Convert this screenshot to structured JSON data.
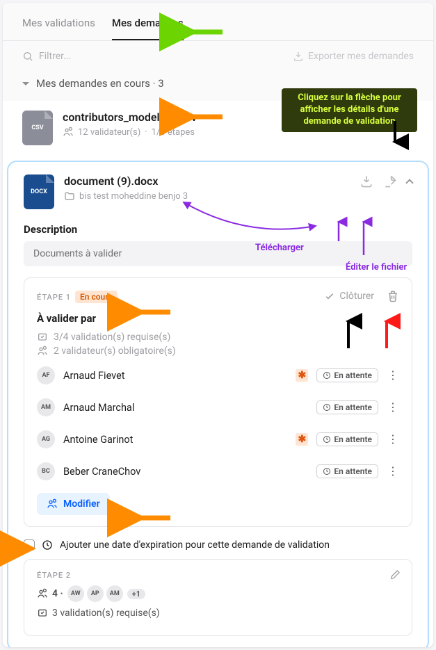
{
  "tabs": {
    "validations": "Mes validations",
    "demandes": "Mes demandes"
  },
  "toolbar": {
    "filter_placeholder": "Filtrer...",
    "export_label": "Exporter mes demandes"
  },
  "section": {
    "title": "Mes demandes en cours · 3"
  },
  "file1": {
    "ext": "CSV",
    "name": "contributors_model (1).csv",
    "validators": "12 validateur(s)",
    "steps": "1/3 étapes",
    "count": "12"
  },
  "file2": {
    "ext": "DOCX",
    "name": "document (9).docx",
    "path": "bis test moheddine benjo 3"
  },
  "description": {
    "heading": "Description",
    "text": "Documents à valider"
  },
  "step1": {
    "tag": "ÉTAPE 1",
    "status": "En cours",
    "close_label": "Clôturer",
    "validate_heading": "À valider par",
    "required": "3/4 validation(s) requise(s)",
    "mandatory": "2 validateur(s) obligatoire(s)",
    "modify_label": "Modifier",
    "waiting": "En attente",
    "validators": [
      {
        "initials": "AF",
        "name": "Arnaud Fievet",
        "mandatory": true
      },
      {
        "initials": "AM",
        "name": "Arnaud Marchal",
        "mandatory": false
      },
      {
        "initials": "AG",
        "name": "Antoine Garinot",
        "mandatory": true
      },
      {
        "initials": "BC",
        "name": "Beber CraneChov",
        "mandatory": false
      }
    ]
  },
  "expiry": {
    "text": "Ajouter une date d'expiration pour cette demande de validation"
  },
  "step2": {
    "tag": "ÉTAPE 2",
    "count_label": "4 ·",
    "avatars": [
      "AW",
      "AP",
      "AM"
    ],
    "more": "+1",
    "required": "3 validation(s) requise(s)"
  },
  "annotations": {
    "callout": "Cliquez sur la flèche\npour afficher les détails\nd'une demande de validation",
    "download": "Télécharger",
    "edit_file": "Éditer le fichier"
  }
}
